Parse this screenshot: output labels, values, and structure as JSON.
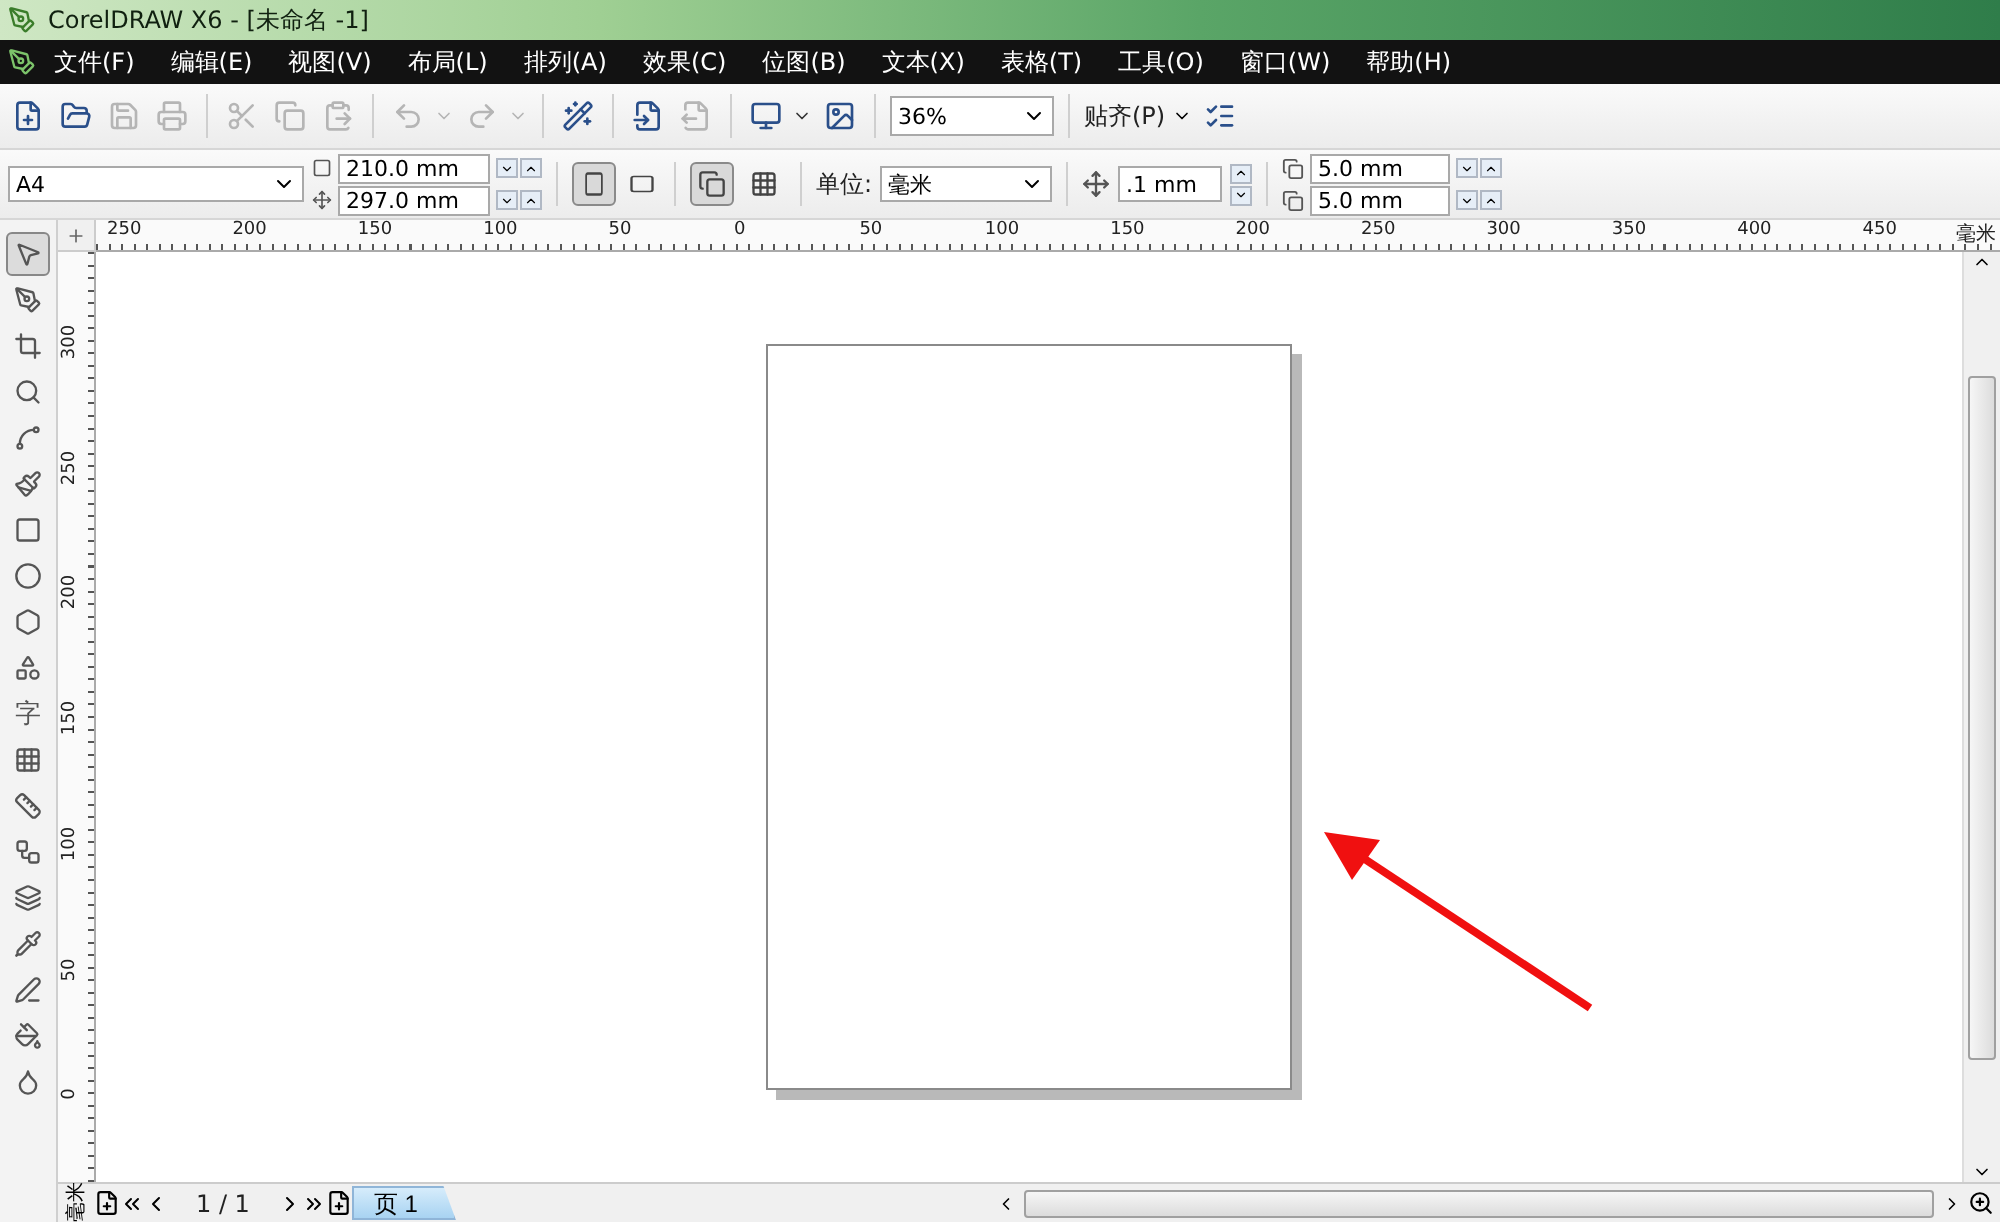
{
  "window": {
    "title": "CorelDRAW X6 - [未命名 -1]"
  },
  "menu": [
    "文件(F)",
    "编辑(E)",
    "视图(V)",
    "布局(L)",
    "排列(A)",
    "效果(C)",
    "位图(B)",
    "文本(X)",
    "表格(T)",
    "工具(O)",
    "窗口(W)",
    "帮助(H)"
  ],
  "toolbar": {
    "groups": [
      [
        {
          "kind": "button",
          "disabled": false
        },
        {
          "kind": "button",
          "disabled": false
        },
        {
          "kind": "button",
          "disabled": true
        },
        {
          "kind": "button",
          "disabled": true
        }
      ],
      [
        {
          "kind": "button",
          "disabled": true
        },
        {
          "kind": "button",
          "disabled": true
        },
        {
          "kind": "button",
          "disabled": true
        }
      ],
      [
        {
          "kind": "split",
          "disabled": true
        },
        {
          "kind": "split",
          "disabled": true
        }
      ],
      [
        {
          "kind": "button",
          "disabled": false
        }
      ],
      [
        {
          "kind": "button",
          "disabled": false
        },
        {
          "kind": "button",
          "disabled": true
        }
      ],
      [
        {
          "kind": "split",
          "disabled": false
        },
        {
          "kind": "button",
          "disabled": false
        }
      ],
      [
        {
          "kind": "zoom",
          "value": "36%"
        }
      ],
      [
        {
          "kind": "snap",
          "label": "贴齐(P)"
        },
        {
          "kind": "button",
          "disabled": false
        }
      ]
    ]
  },
  "property_bar": {
    "page_size": "A4",
    "width": "210.0 mm",
    "height": "297.0 mm",
    "orientation": [
      {
        "selected": true
      },
      {
        "selected": false
      }
    ],
    "page_layout": [
      {
        "selected": true
      },
      {
        "selected": false
      }
    ],
    "unit_label": "单位:",
    "unit": "毫米",
    "nudge": ".1 mm",
    "duplicate_x": "5.0 mm",
    "duplicate_y": "5.0 mm"
  },
  "toolbox": [
    {
      "selected": true
    },
    {
      "selected": false
    },
    {
      "selected": false
    },
    {
      "selected": false
    },
    {
      "selected": false
    },
    {
      "selected": false
    },
    {
      "selected": false
    },
    {
      "selected": false
    },
    {
      "selected": false
    },
    {
      "selected": false
    },
    {
      "selected": false,
      "glyph": "字"
    },
    {
      "selected": false
    },
    {
      "selected": false
    },
    {
      "selected": false
    },
    {
      "selected": false
    },
    {
      "selected": false
    },
    {
      "selected": false
    },
    {
      "selected": false
    },
    {
      "selected": false
    }
  ],
  "horizontal_ruler": {
    "labels": [
      "250",
      "200",
      "150",
      "100",
      "50",
      "0",
      "50",
      "100",
      "150",
      "200",
      "250",
      "300",
      "350",
      "400",
      "450"
    ],
    "unit": "毫米"
  },
  "vertical_ruler": {
    "labels": [
      "300",
      "250",
      "200",
      "150",
      "100",
      "50",
      "0"
    ],
    "unit": "毫米"
  },
  "status_bar": {
    "page_counter": "1 / 1",
    "pages": [
      {
        "label": "页 1",
        "selected": true
      }
    ]
  }
}
